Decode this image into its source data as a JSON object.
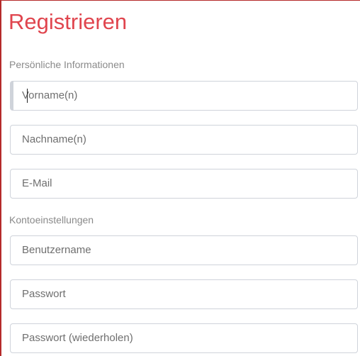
{
  "form": {
    "title": "Registrieren",
    "sections": [
      {
        "label": "Persönliche Informationen",
        "fields": [
          {
            "placeholder": "Vorname(n)"
          },
          {
            "placeholder": "Nachname(n)"
          },
          {
            "placeholder": "E-Mail"
          }
        ]
      },
      {
        "label": "Kontoeinstellungen",
        "fields": [
          {
            "placeholder": "Benutzername"
          },
          {
            "placeholder": "Passwort"
          },
          {
            "placeholder": "Passwort (wiederholen)"
          }
        ]
      }
    ]
  }
}
